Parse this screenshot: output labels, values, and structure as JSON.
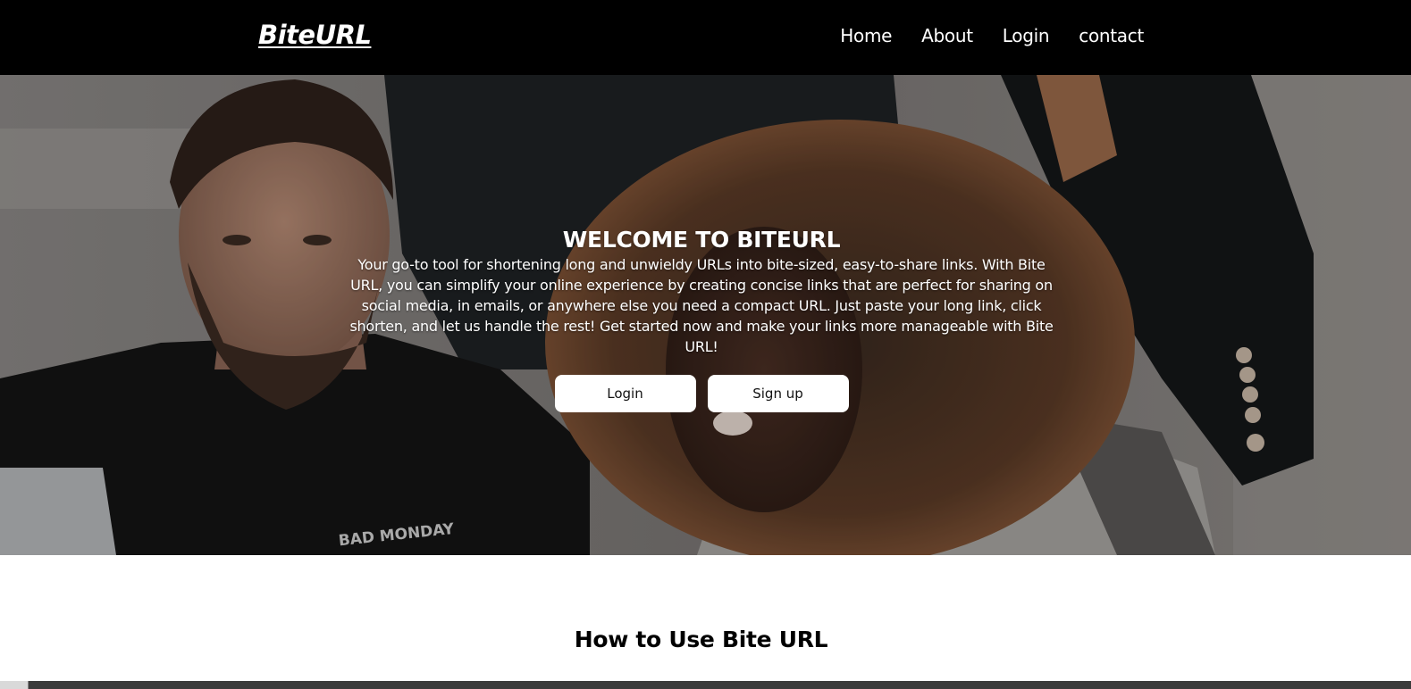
{
  "navbar": {
    "brand": "BiteURL",
    "links": [
      {
        "label": "Home"
      },
      {
        "label": "About"
      },
      {
        "label": "Login"
      },
      {
        "label": "contact"
      }
    ]
  },
  "hero": {
    "title": "WELCOME TO BITEURL",
    "description": "Your go-to tool for shortening long and unwieldy URLs into bite-sized, easy-to-share links. With Bite URL, you can simplify your online experience by creating concise links that are perfect for sharing on social media, in emails, or anywhere else you need a compact URL. Just paste your long link, click shorten, and let us handle the rest! Get started now and make your links more manageable with Bite URL!",
    "login_button": "Login",
    "signup_button": "Sign up",
    "photo_text": "BAD MONDAY"
  },
  "how_to": {
    "title": "How to Use Bite URL"
  },
  "colors": {
    "navbar_bg": "#000000",
    "button_bg": "#ffffff",
    "page_bg": "#ffffff"
  }
}
